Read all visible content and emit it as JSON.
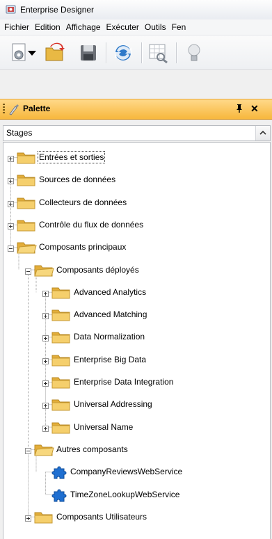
{
  "window": {
    "title": "Enterprise Designer"
  },
  "menu": [
    "Fichier",
    "Edition",
    "Affichage",
    "Exécuter",
    "Outils",
    "Fen"
  ],
  "toolbar": [
    {
      "icon": "settings-gear-icon"
    },
    {
      "icon": "dropdown-arrow-icon"
    },
    {
      "icon": "open-folder-icon"
    },
    {
      "icon": "save-disk-icon"
    },
    {
      "icon": "refresh-globe-icon"
    },
    {
      "icon": "inspect-grid-icon"
    },
    {
      "icon": "lightbulb-icon"
    }
  ],
  "palette": {
    "title": "Palette",
    "pin": "ᵖ",
    "close": "✕"
  },
  "stages": {
    "label": "Stages"
  },
  "tree": {
    "items": [
      {
        "label": "Entrées et sorties",
        "level": 0,
        "expanded": false
      },
      {
        "label": "Sources de données",
        "level": 0,
        "expanded": false
      },
      {
        "label": "Collecteurs de données",
        "level": 0,
        "expanded": false
      },
      {
        "label": "Contrôle du flux de données",
        "level": 0,
        "expanded": false
      },
      {
        "label": "Composants principaux",
        "level": 0,
        "expanded": true
      },
      {
        "label": "Composants déployés",
        "level": 1,
        "expanded": true
      },
      {
        "label": "Advanced Analytics",
        "level": 2,
        "expanded": false
      },
      {
        "label": "Advanced Matching",
        "level": 2,
        "expanded": false
      },
      {
        "label": "Data Normalization",
        "level": 2,
        "expanded": false
      },
      {
        "label": "Enterprise Big Data",
        "level": 2,
        "expanded": false
      },
      {
        "label": "Enterprise Data Integration",
        "level": 2,
        "expanded": false
      },
      {
        "label": "Universal Addressing",
        "level": 2,
        "expanded": false
      },
      {
        "label": "Universal Name",
        "level": 2,
        "expanded": false
      },
      {
        "label": "Autres composants",
        "level": 1,
        "expanded": true
      },
      {
        "label": "CompanyReviewsWebService",
        "level": 2,
        "leaf": true
      },
      {
        "label": "TimeZoneLookupWebService",
        "level": 2,
        "leaf": true
      },
      {
        "label": "Composants Utilisateurs",
        "level": 1,
        "expanded": false
      }
    ]
  },
  "colors": {
    "palette_header": "#f7b73c",
    "folder": "#f4c758",
    "puzzle": "#1f6fd1"
  }
}
